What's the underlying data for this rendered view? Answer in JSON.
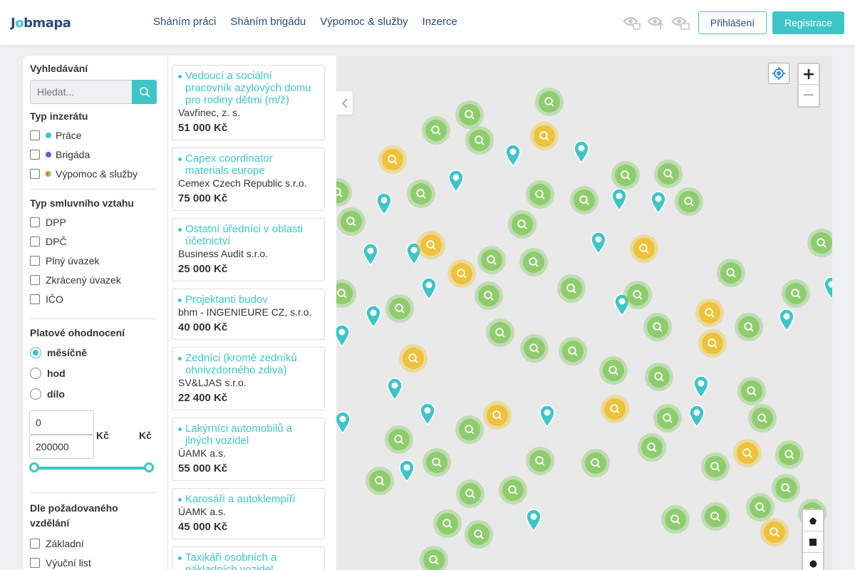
{
  "header": {
    "logo": {
      "part1": "J",
      "part2": "bmapa"
    },
    "nav": [
      "Sháním práci",
      "Sháním brigádu",
      "Výpomoc & služby",
      "Inzerce"
    ],
    "login_label": "Přihlášení",
    "register_label": "Registrace",
    "icons": [
      "eye-lock-icon",
      "eye-upload-icon",
      "eye-message-icon"
    ]
  },
  "filters": {
    "search_title": "Vyhledávání",
    "search_placeholder": "Hledat...",
    "type_title": "Typ inzerátu",
    "types": [
      {
        "label": "Práce",
        "color": "#3ec5c8"
      },
      {
        "label": "Brigáda",
        "color": "#7b4fd8"
      },
      {
        "label": "Výpomoc & služby",
        "color": "#e8733a"
      }
    ],
    "contract_title": "Typ smluvního vztahu",
    "contracts": [
      "DPP",
      "DPČ",
      "Plný úvazek",
      "Zkrácený úvazek",
      "IČO"
    ],
    "salary_title": "Platové ohodnocení",
    "salary_modes": [
      "měsíčně",
      "hod",
      "dílo"
    ],
    "salary_selected": 0,
    "salary_min": "0",
    "salary_max": "200000",
    "currency": "Kč",
    "education_title": "Dle požadovaného vzdělání",
    "education": [
      "Základní",
      "Výuční list"
    ]
  },
  "jobs": [
    {
      "title": "Vedoucí a sociální pracovník azylových domu pro rodiny dětmi (m/ž)",
      "company": "Vavřinec, z. s.",
      "salary": "51 000 Kč"
    },
    {
      "title": "Capex coordinator materials europe",
      "company": "Cemex Czech Republic s.r.o.",
      "salary": "75 000 Kč"
    },
    {
      "title": "Ostatní úředníci v oblasti účetnictví",
      "company": "Business Audit s.r.o.",
      "salary": "25 000 Kč"
    },
    {
      "title": "Projektanti budov",
      "company": "bhm - INGENIEURE CZ, s.r.o.",
      "salary": "40 000 Kč"
    },
    {
      "title": "Zedníci (kromě zedníků ohnivzdorného zdiva)",
      "company": "SV&LJAS s.r.o.",
      "salary": "22 400 Kč"
    },
    {
      "title": "Lakýrníci automobilů a jiných vozidel",
      "company": "ÚAMK a.s.",
      "salary": "55 000 Kč"
    },
    {
      "title": "Karosáři a autoklempíři",
      "company": "ÚAMK a.s.",
      "salary": "45 000 Kč"
    },
    {
      "title": "Taxikáři osobních a nákladních vozidel",
      "company": "",
      "salary": ""
    }
  ],
  "map": {
    "zoom_in": "+",
    "zoom_out": "−",
    "colors": {
      "green": "#8fcc6e",
      "yellow": "#eec23c",
      "pin": "#3ec5c8"
    }
  }
}
